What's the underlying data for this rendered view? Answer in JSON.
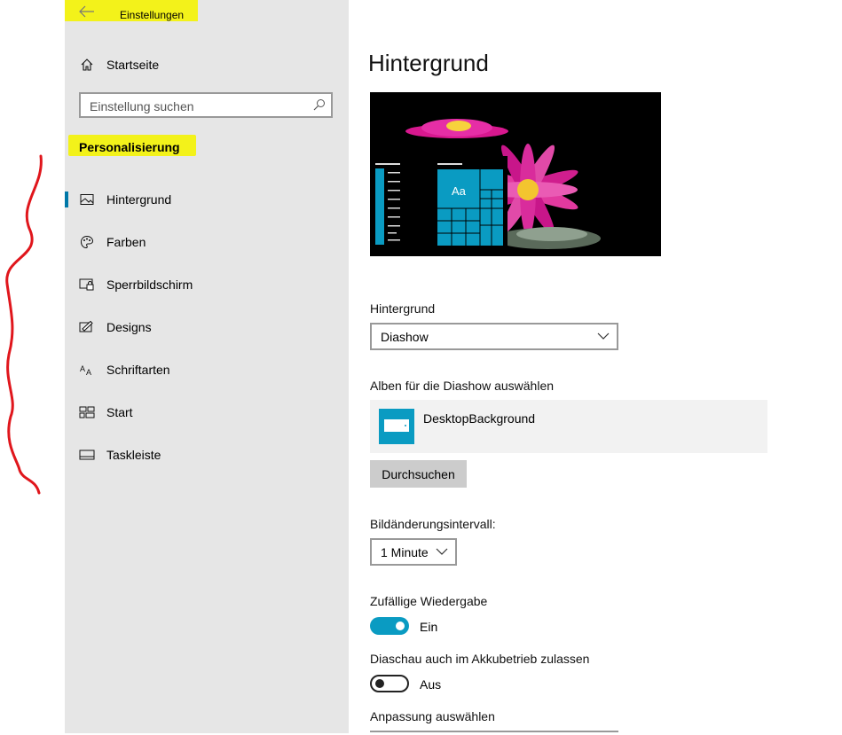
{
  "window": {
    "title": "Einstellungen"
  },
  "sidebar": {
    "home_label": "Startseite",
    "search_placeholder": "Einstellung suchen",
    "section_title": "Personalisierung",
    "items": [
      {
        "label": "Hintergrund",
        "icon": "picture-icon",
        "selected": true
      },
      {
        "label": "Farben",
        "icon": "palette-icon"
      },
      {
        "label": "Sperrbildschirm",
        "icon": "lock-screen-icon"
      },
      {
        "label": "Designs",
        "icon": "designs-icon"
      },
      {
        "label": "Schriftarten",
        "icon": "fonts-icon"
      },
      {
        "label": "Start",
        "icon": "start-icon"
      },
      {
        "label": "Taskleiste",
        "icon": "taskbar-icon"
      }
    ]
  },
  "main": {
    "title": "Hintergrund",
    "preview_tile_text": "Aa",
    "background_label": "Hintergrund",
    "background_value": "Diashow",
    "album_label": "Alben für die Diashow auswählen",
    "album_name": "DesktopBackground",
    "browse_label": "Durchsuchen",
    "interval_label": "Bildänderungsintervall:",
    "interval_value": "1 Minute",
    "shuffle_label": "Zufällige Wiedergabe",
    "shuffle_state": "Ein",
    "shuffle_on": true,
    "battery_label": "Diaschau auch im Akkubetrieb zulassen",
    "battery_state": "Aus",
    "battery_on": false,
    "fit_label": "Anpassung auswählen"
  },
  "colors": {
    "accent": "#0a9bc2",
    "highlight": "#f3f21a",
    "sidebar_bg": "#e6e6e6",
    "annotation_red": "#e0161c"
  }
}
